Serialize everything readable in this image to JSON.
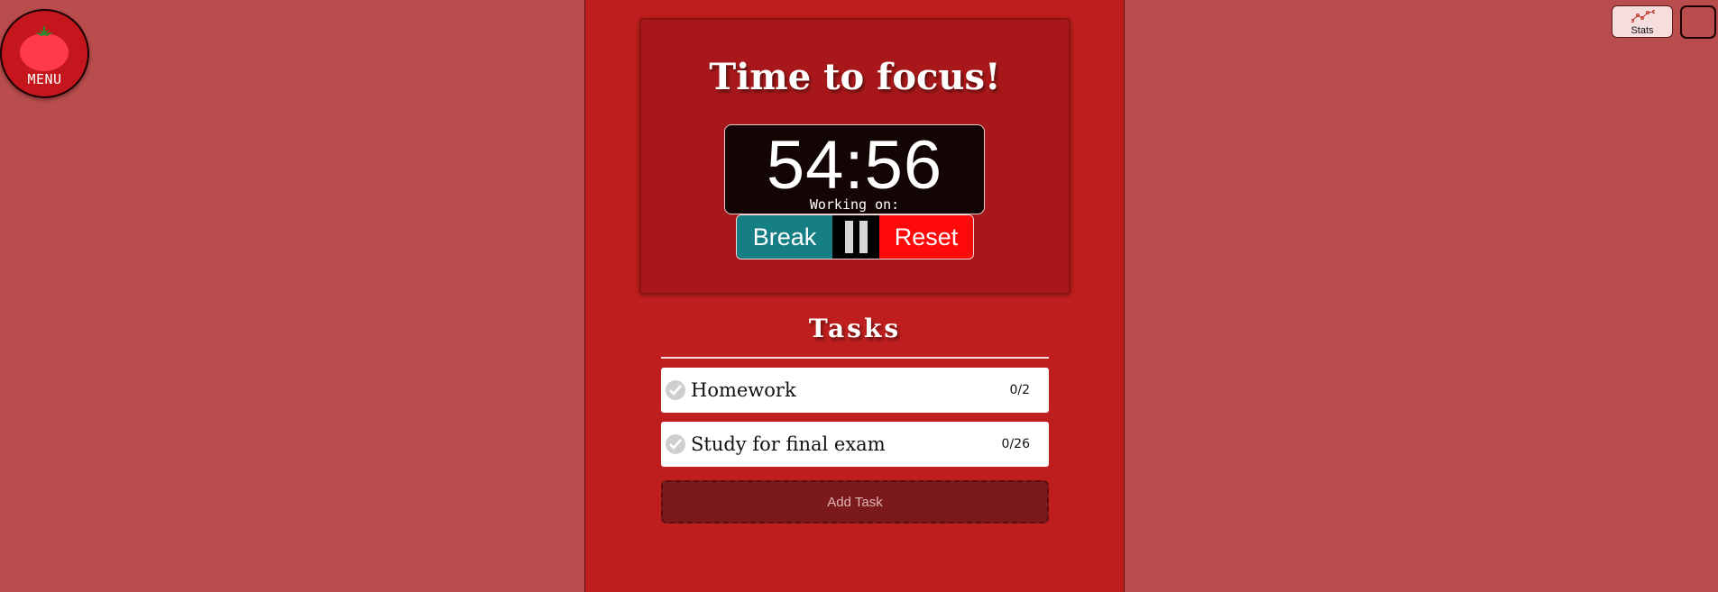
{
  "menu": {
    "label": "MENU",
    "icon": "tomato-icon"
  },
  "header": {
    "stats_label": "Stats",
    "stats_icon": "line-chart-icon"
  },
  "timer": {
    "title": "Time to focus!",
    "minutes": "54",
    "separator": ":",
    "seconds": "56",
    "working_on_label": "Working on:",
    "break_label": "Break",
    "pause_icon": "pause-icon",
    "reset_label": "Reset"
  },
  "tasks": {
    "title": "Tasks",
    "items": [
      {
        "name": "Homework",
        "count": "0/2"
      },
      {
        "name": "Study for final exam",
        "count": "0/26"
      }
    ],
    "add_label": "Add Task"
  },
  "colors": {
    "page_bg": "#b94c4c",
    "column_bg": "#be1e1e",
    "card_bg": "#a8181a",
    "break_button": "#167f86",
    "reset_button": "#ff0a0a",
    "add_task_bg": "#7a1a1c"
  }
}
